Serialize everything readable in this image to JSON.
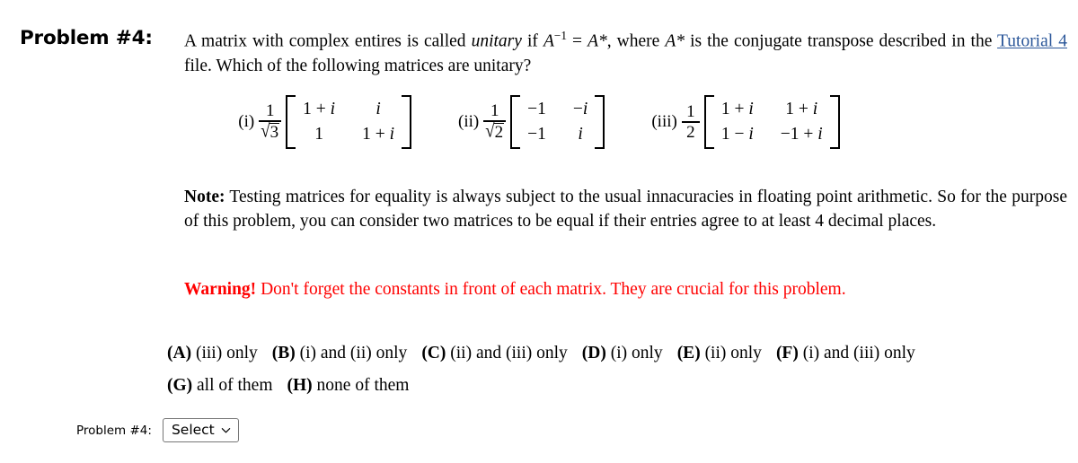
{
  "problem": {
    "label": "Problem #4:",
    "statement_part1": "A matrix with complex entires is called ",
    "statement_italic": "unitary",
    "statement_part2": " if ",
    "eq_a": "A",
    "eq_sup": "−1",
    "eq_mid": " = ",
    "eq_astar": "A*",
    "statement_part3": ", where ",
    "eq_astar2": "A*",
    "statement_part4": " is the conjugate transpose described in the ",
    "link_text": "Tutorial 4",
    "statement_part5": " file. Which of the following matrices are unitary?"
  },
  "matrices": [
    {
      "roman": "(i)",
      "coeff_num": "1",
      "coeff_den_radicand": "3",
      "coeff_type": "sqrt",
      "cells": [
        "1 + i",
        "i",
        "1",
        "1 + i"
      ]
    },
    {
      "roman": "(ii)",
      "coeff_num": "1",
      "coeff_den_radicand": "2",
      "coeff_type": "sqrt",
      "cells": [
        "−1",
        "−i",
        "−1",
        "i"
      ]
    },
    {
      "roman": "(iii)",
      "coeff_num": "1",
      "coeff_den_plain": "2",
      "coeff_type": "plain",
      "cells": [
        "1 + i",
        "1 + i",
        "1 − i",
        "−1 + i"
      ]
    }
  ],
  "note": {
    "label": "Note:",
    "text": " Testing matrices for equality is always subject to the usual innacuracies in floating point arithmetic. So for the purpose of this problem, you can consider two matrices to be equal if their entries agree to at least 4 decimal places."
  },
  "warning": {
    "label": "Warning!",
    "text": " Don't forget the constants in front of each matrix. They are crucial for this problem.",
    "color": "#ff0000"
  },
  "choices": [
    {
      "tag": "(A)",
      "text": " (iii) only"
    },
    {
      "tag": "(B)",
      "text": " (i) and (ii) only"
    },
    {
      "tag": "(C)",
      "text": " (ii) and (iii) only"
    },
    {
      "tag": "(D)",
      "text": " (i) only"
    },
    {
      "tag": "(E)",
      "text": " (ii) only"
    },
    {
      "tag": "(F)",
      "text": " (i) and (iii) only"
    },
    {
      "tag": "(G)",
      "text": " all of them"
    },
    {
      "tag": "(H)",
      "text": " none of them"
    }
  ],
  "answer": {
    "label": "Problem #4:",
    "select_value": "Select",
    "chevron_icon": "chevron-down-icon"
  },
  "colors": {
    "link": "#2a5699",
    "warning": "#ff0000",
    "text": "#000000",
    "select_border": "#767676"
  }
}
